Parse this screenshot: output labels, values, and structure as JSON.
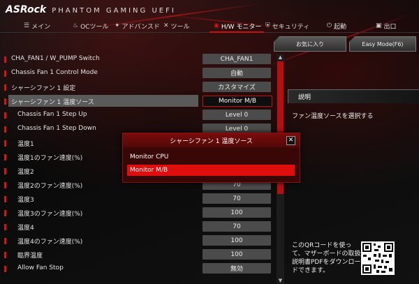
{
  "brand": {
    "logo": "ASRock",
    "subtitle": "PHANTOM GAMING UEFI"
  },
  "nav": {
    "items": [
      {
        "icon": "list-icon",
        "glyph": "☰",
        "label": "メイン"
      },
      {
        "icon": "flame-icon",
        "glyph": "♨",
        "label": "OCツール"
      },
      {
        "icon": "star-icon",
        "glyph": "✦",
        "label": "アドバンスド"
      },
      {
        "icon": "tools-icon",
        "glyph": "✕",
        "label": "ツール"
      },
      {
        "icon": "monitor-icon",
        "glyph": "◉",
        "label": "H/W モニター"
      },
      {
        "icon": "shield-icon",
        "glyph": "⛨",
        "label": "セキュリティ"
      },
      {
        "icon": "power-icon",
        "glyph": "⏻",
        "label": "起動"
      },
      {
        "icon": "exit-icon",
        "glyph": "▣",
        "label": "出口"
      }
    ],
    "active_index": 4
  },
  "toolbar": {
    "favorite": "お気に入り",
    "easy_mode": "Easy Mode(F6)"
  },
  "settings": [
    {
      "label": "CHA_FAN1 / W_PUMP Switch",
      "value": "CHA_FAN1"
    },
    {
      "label": "Chassis Fan 1 Control Mode",
      "value": "自動"
    },
    {
      "label": "シャーシファン 1 設定",
      "value": "カスタマイズ"
    },
    {
      "label": "シャーシファン 1 温度ソース",
      "value": "Monitor M/B"
    },
    {
      "label": "Chassis Fan 1 Step Up",
      "value": "Level 0"
    },
    {
      "label": "Chassis Fan 1 Step Down",
      "value": "Level 0"
    },
    {
      "label": "温度1",
      "value": ""
    },
    {
      "label": "温度1のファン速度(%)",
      "value": ""
    },
    {
      "label": "温度2",
      "value": ""
    },
    {
      "label": "温度2のファン速度(%)",
      "value": "70"
    },
    {
      "label": "温度3",
      "value": "70"
    },
    {
      "label": "温度3のファン速度(%)",
      "value": "100"
    },
    {
      "label": "温度4",
      "value": "70"
    },
    {
      "label": "温度4のファン速度(%)",
      "value": "100"
    },
    {
      "label": "臨界温度",
      "value": "100"
    },
    {
      "label": "Allow Fan Stop",
      "value": "無効"
    }
  ],
  "description": {
    "heading": "説明",
    "text": "ファン温度ソースを選択する"
  },
  "qr": {
    "text": "このQRコードを使って、マザーボードの取扱説明書PDFをダウンロードできます。"
  },
  "dialog": {
    "title": "シャーシファン 1 温度ソース",
    "options": [
      "Monitor CPU",
      "Monitor M/B"
    ],
    "selected_index": 1
  },
  "colors": {
    "accent": "#e00d0d",
    "dialog_bg": "#3a0707"
  }
}
